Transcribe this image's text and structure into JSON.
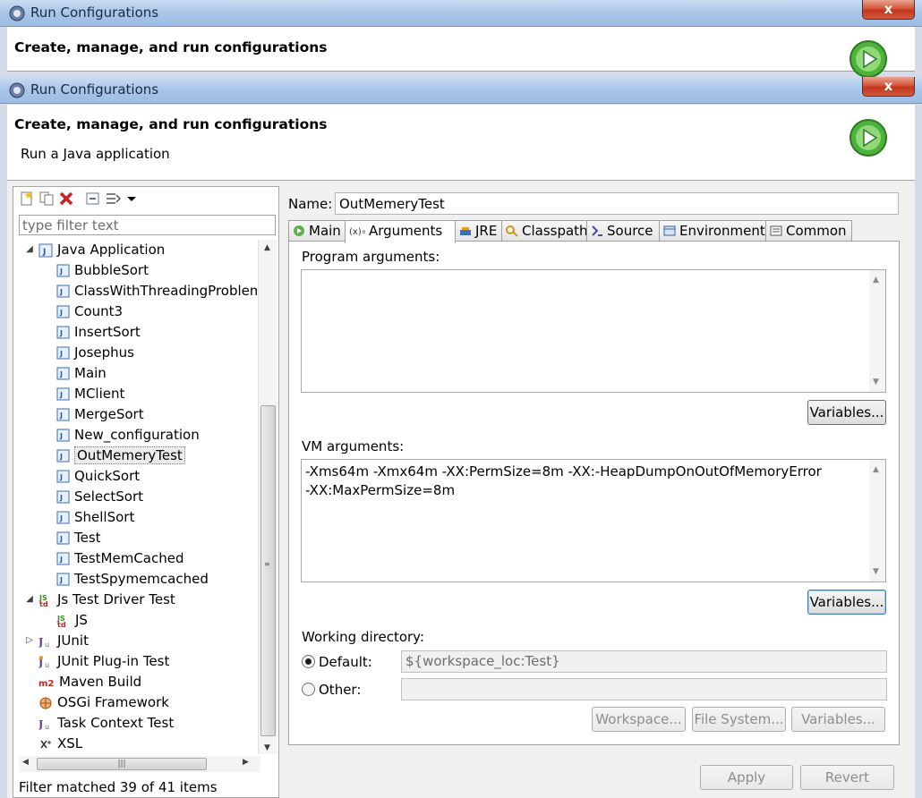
{
  "window": {
    "title": "Run Configurations",
    "close_label": "x"
  },
  "banner": {
    "title": "Create, manage, and run configurations",
    "subtitle": "Run a Java application"
  },
  "left": {
    "filter_placeholder": "type filter text",
    "tree": [
      {
        "label": "Java Application",
        "level": 0,
        "icon": "java-application-icon",
        "expanded": true
      },
      {
        "label": "BubbleSort",
        "level": 1,
        "icon": "java-config-icon"
      },
      {
        "label": "ClassWithThreadingProblem",
        "level": 1,
        "icon": "java-config-icon"
      },
      {
        "label": "Count3",
        "level": 1,
        "icon": "java-config-icon"
      },
      {
        "label": "InsertSort",
        "level": 1,
        "icon": "java-config-icon"
      },
      {
        "label": "Josephus",
        "level": 1,
        "icon": "java-config-icon"
      },
      {
        "label": "Main",
        "level": 1,
        "icon": "java-config-icon"
      },
      {
        "label": "MClient",
        "level": 1,
        "icon": "java-config-icon"
      },
      {
        "label": "MergeSort",
        "level": 1,
        "icon": "java-config-icon"
      },
      {
        "label": "New_configuration",
        "level": 1,
        "icon": "java-config-icon"
      },
      {
        "label": "OutMemeryTest",
        "level": 1,
        "icon": "java-config-icon",
        "selected": true
      },
      {
        "label": "QuickSort",
        "level": 1,
        "icon": "java-config-icon"
      },
      {
        "label": "SelectSort",
        "level": 1,
        "icon": "java-config-icon"
      },
      {
        "label": "ShellSort",
        "level": 1,
        "icon": "java-config-icon"
      },
      {
        "label": "Test",
        "level": 1,
        "icon": "java-config-icon"
      },
      {
        "label": "TestMemCached",
        "level": 1,
        "icon": "java-config-icon"
      },
      {
        "label": "TestSpymemcached",
        "level": 1,
        "icon": "java-config-icon"
      },
      {
        "label": "Js Test Driver Test",
        "level": 0,
        "icon": "js-test-driver-icon",
        "expanded": true
      },
      {
        "label": "JS",
        "level": 1,
        "icon": "js-test-driver-icon"
      },
      {
        "label": "JUnit",
        "level": 0,
        "icon": "junit-icon",
        "expanded": false
      },
      {
        "label": "JUnit Plug-in Test",
        "level": 0,
        "icon": "junit-plugin-icon"
      },
      {
        "label": "Maven Build",
        "level": 0,
        "icon": "maven-icon"
      },
      {
        "label": "OSGi Framework",
        "level": 0,
        "icon": "osgi-icon"
      },
      {
        "label": "Task Context Test",
        "level": 0,
        "icon": "task-context-icon"
      },
      {
        "label": "XSL",
        "level": 0,
        "icon": "xsl-icon"
      }
    ],
    "status": "Filter matched 39 of 41 items"
  },
  "right": {
    "name_label": "Name:",
    "name_value": "OutMemeryTest",
    "tabs": [
      {
        "label": "Main",
        "icon": "main-tab-icon"
      },
      {
        "label": "Arguments",
        "icon": "arguments-tab-icon",
        "active": true
      },
      {
        "label": "JRE",
        "icon": "jre-tab-icon"
      },
      {
        "label": "Classpath",
        "icon": "classpath-tab-icon"
      },
      {
        "label": "Source",
        "icon": "source-tab-icon"
      },
      {
        "label": "Environment",
        "icon": "environment-tab-icon"
      },
      {
        "label": "Common",
        "icon": "common-tab-icon"
      }
    ],
    "program_args_label": "Program arguments:",
    "program_args_value": "",
    "variables_label": "Variables...",
    "vm_args_label": "VM arguments:",
    "vm_args_value": "-Xms64m -Xmx64m -XX:PermSize=8m -XX:-HeapDumpOnOutOfMemoryError\n-XX:MaxPermSize=8m",
    "working_dir_label": "Working directory:",
    "default_label": "Default:",
    "default_value": "${workspace_loc:Test}",
    "other_label": "Other:",
    "other_value": "",
    "workspace_label": "Workspace...",
    "filesystem_label": "File System...",
    "variables2_label": "Variables...",
    "apply_label": "Apply",
    "revert_label": "Revert"
  }
}
